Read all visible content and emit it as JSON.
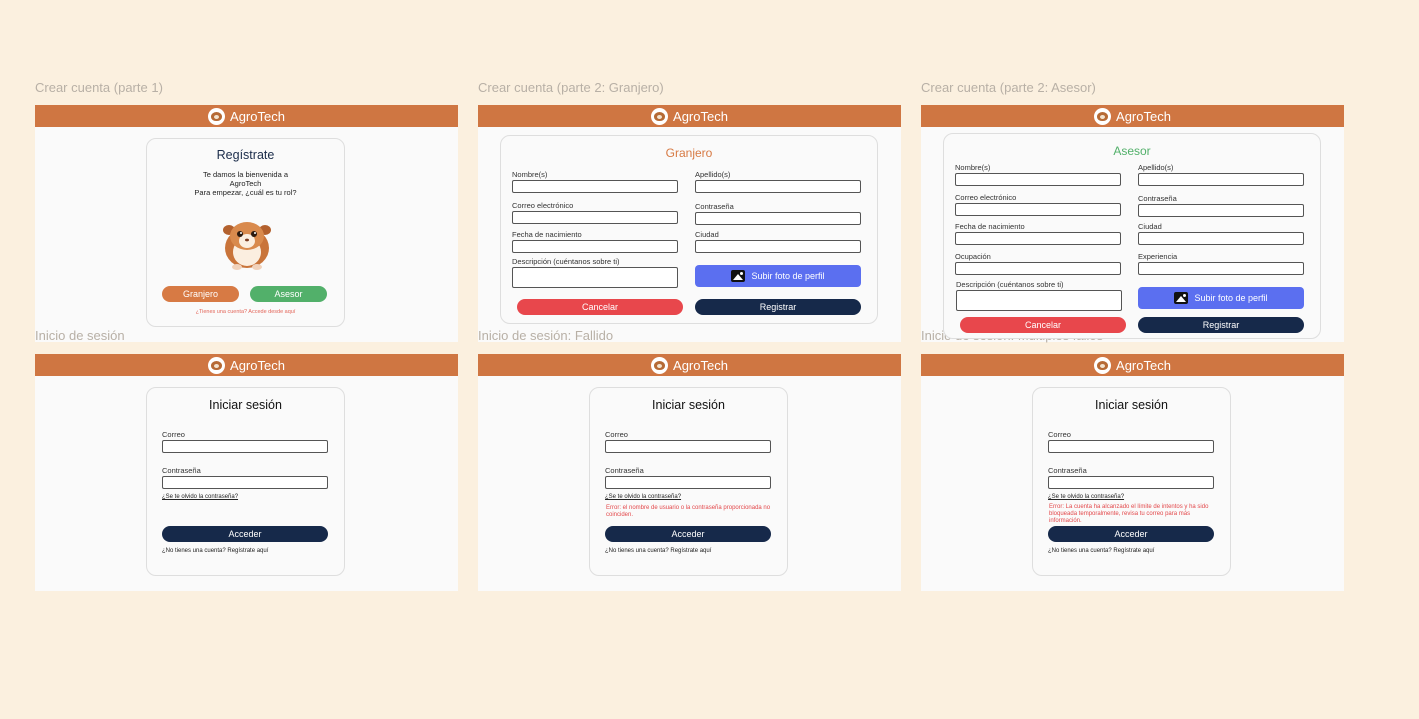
{
  "brand": "AgroTech",
  "frames": {
    "f1": {
      "label": "Crear cuenta (parte 1)"
    },
    "f2": {
      "label": "Crear cuenta (parte 2: Granjero)"
    },
    "f3": {
      "label": "Crear cuenta (parte 2: Asesor)"
    },
    "f4": {
      "label": "Inicio de sesión"
    },
    "f5": {
      "label": "Inicio de sesión: Fallido"
    },
    "f6": {
      "label": "Inicio de sesión: Multiples fallos"
    }
  },
  "register": {
    "title": "Regístrate",
    "welcome": "Te damos la bienvenida a AgroTech",
    "prompt": "Para empezar, ¿cuál es tu rol?",
    "farmer_btn": "Granjero",
    "advisor_btn": "Asesor",
    "login_link": "¿Tienes una cuenta? Accede desde aquí"
  },
  "form": {
    "farmer_title": "Granjero",
    "advisor_title": "Asesor",
    "name": "Nombre(s)",
    "surname": "Apellido(s)",
    "email": "Correo electrónico",
    "password": "Contraseña",
    "birth": "Fecha de nacimiento",
    "city": "Ciudad",
    "occupation": "Ocupación",
    "experience": "Experiencia",
    "description": "Descripción (cuéntanos sobre ti)",
    "upload": "Subir foto de perfil",
    "cancel": "Cancelar",
    "register": "Registrar"
  },
  "login": {
    "title": "Iniciar sesión",
    "email": "Correo",
    "password": "Contraseña",
    "forgot": "¿Se te olvido la contraseña?",
    "submit": "Acceder",
    "signup": "¿No tienes una cuenta? Regístrate aquí",
    "error_failed": "Error: el nombre de usuario o la contraseña proporcionada no coinciden.",
    "error_locked": "Error: La cuenta ha alcanzado el límite de intentos y ha sido bloqueada temporalmente, revisa tu correo para más información."
  },
  "colors": {
    "header": "#cf7642",
    "farmer": "#d77a44",
    "advisor": "#52b06a",
    "primary": "#16294a",
    "cancel": "#e8474c",
    "upload": "#5b6ff0"
  }
}
